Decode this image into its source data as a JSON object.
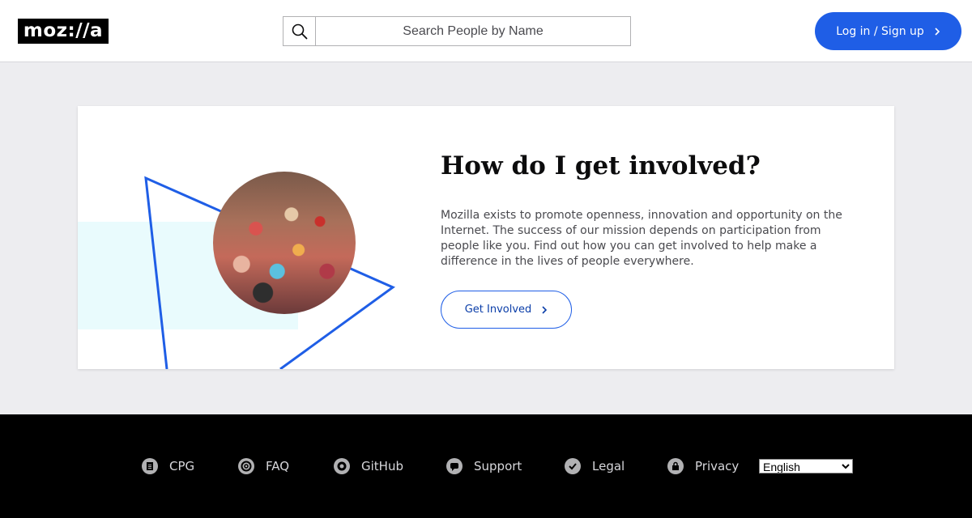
{
  "header": {
    "logo_text": "moz://a",
    "search_placeholder": "Search People by Name",
    "login_label": "Log in / Sign up"
  },
  "card": {
    "heading": "How do I get involved?",
    "body": "Mozilla exists to promote openness, innovation and opportunity on the Internet. The success of our mission depends on participation from people like you. Find out how you can get involved to help make a difference in the lives of people everywhere.",
    "button_label": "Get Involved"
  },
  "footer": {
    "links": [
      {
        "label": "CPG",
        "icon": "document-icon"
      },
      {
        "label": "FAQ",
        "icon": "lifebuoy-icon"
      },
      {
        "label": "GitHub",
        "icon": "github-icon"
      },
      {
        "label": "Support",
        "icon": "chat-icon"
      },
      {
        "label": "Legal",
        "icon": "checkmark-icon"
      },
      {
        "label": "Privacy",
        "icon": "lock-icon"
      }
    ],
    "language_selected": "English"
  },
  "colors": {
    "accent": "#1f5ee6",
    "page_bg": "#ededf0",
    "footer_bg": "#000000",
    "art_band": "#e9fbfd",
    "triangle_stroke": "#1f5ee6"
  }
}
